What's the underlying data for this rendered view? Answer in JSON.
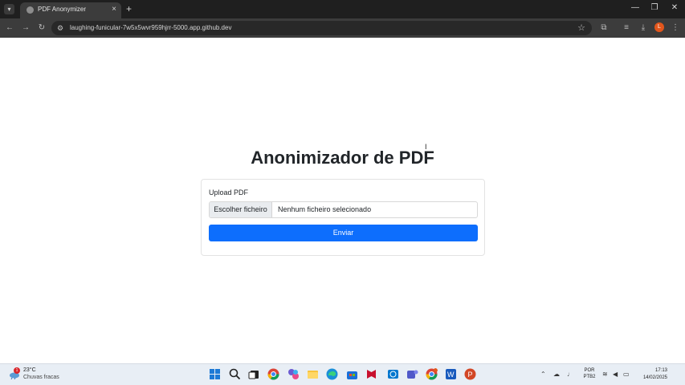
{
  "browser": {
    "tab_title": "PDF Anonymizer",
    "tab_close": "×",
    "new_tab": "+",
    "url": "laughing-funicular-7w5x5wvr959hjrr-5000.app.github.dev",
    "icons": [
      "tab-search-icon",
      "back-icon",
      "forward-icon",
      "reload-icon",
      "site-info-icon",
      "bookmark-star-icon",
      "extensions-icon",
      "downloads-icon",
      "profile-icon",
      "menu-icon"
    ],
    "profile_initial": "L",
    "window_controls": {
      "minimize": "—",
      "maximize": "❐",
      "close": "✕"
    }
  },
  "page": {
    "heading": "Anonimizador de PDF",
    "form": {
      "label": "Upload PDF",
      "file_button": "Escolher ficheiro",
      "file_status": "Nenhum ficheiro selecionado",
      "submit": "Enviar"
    }
  },
  "taskbar": {
    "weather": {
      "temp": "23°C",
      "desc": "Chuvas fracas",
      "badge": "1"
    },
    "apps": [
      "start",
      "search",
      "task-view",
      "chrome",
      "copilot",
      "file-explorer",
      "edge",
      "store",
      "mcafee",
      "dell",
      "teams",
      "chrome-active",
      "word",
      "powerpoint"
    ],
    "language": {
      "line1": "POR",
      "line2": "PTB2"
    },
    "clock": {
      "time": "17:13",
      "date": "14/02/2025"
    }
  },
  "colors": {
    "primary": "#0d6efd",
    "heading": "#212529",
    "tab_bg": "#1f1f1f",
    "toolbar_bg": "#3c3c3c"
  }
}
